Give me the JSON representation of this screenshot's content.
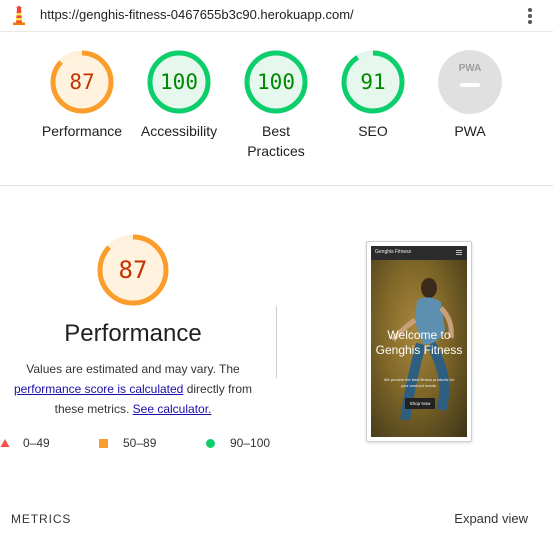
{
  "header": {
    "url": "https://genghis-fitness-0467655b3c90.herokuapp.com/",
    "logo_icon": "lighthouse-icon",
    "menu_icon": "more-vert-icon"
  },
  "colors": {
    "average": "#fa9d2b",
    "good": "#0cce6b",
    "fail": "#ff4e42",
    "na": "#9e9e9e"
  },
  "gauges": [
    {
      "label": "Performance",
      "score": "87",
      "value": 87,
      "rating": "average"
    },
    {
      "label": "Accessibility",
      "score": "100",
      "value": 100,
      "rating": "good"
    },
    {
      "label": "Best Practices",
      "score": "100",
      "value": 100,
      "rating": "good"
    },
    {
      "label": "SEO",
      "score": "91",
      "value": 91,
      "rating": "good"
    },
    {
      "label": "PWA",
      "score": "PWA",
      "value": null,
      "rating": "na"
    }
  ],
  "performance": {
    "score": "87",
    "value": 87,
    "title": "Performance",
    "desc_1": "Values are estimated and may vary. The",
    "link_1": "performance score is calculated",
    "desc_2": "directly from",
    "desc_3": "these metrics.",
    "link_2": "See calculator."
  },
  "legend": [
    {
      "icon": "triangle-icon",
      "range": "0–49"
    },
    {
      "icon": "square-icon",
      "range": "50–89"
    },
    {
      "icon": "circle-icon",
      "range": "90–100"
    }
  ],
  "screenshot": {
    "brand": "Genghis Fitness",
    "heading": "Welcome to Genghis Fitness",
    "sub": "We provide the best fitness products for your workout needs.",
    "button": "Shop Now"
  },
  "metrics": {
    "label": "METRICS",
    "expand": "Expand view"
  }
}
